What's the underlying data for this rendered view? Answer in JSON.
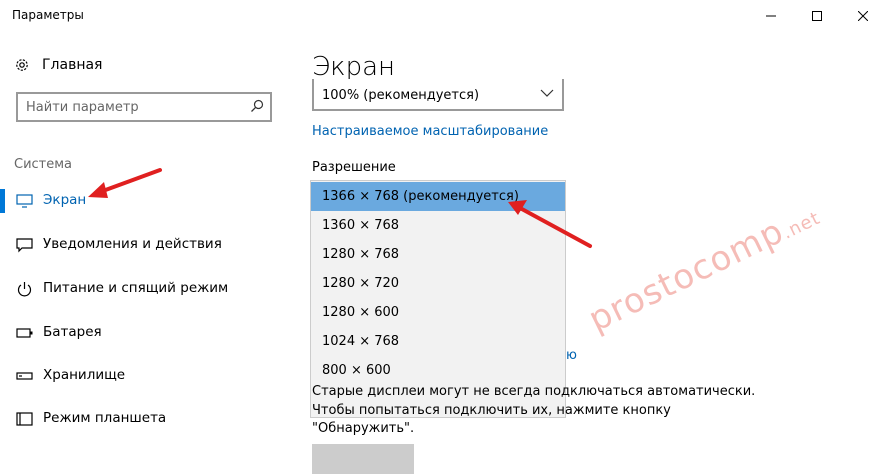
{
  "window": {
    "title": "Параметры"
  },
  "sidebar": {
    "home_label": "Главная",
    "search_placeholder": "Найти параметр",
    "section_label": "Система",
    "items": [
      {
        "label": "Экран",
        "icon": "monitor-icon",
        "active": true
      },
      {
        "label": "Уведомления и действия",
        "icon": "notification-icon",
        "active": false
      },
      {
        "label": "Питание и спящий режим",
        "icon": "power-icon",
        "active": false
      },
      {
        "label": "Батарея",
        "icon": "battery-icon",
        "active": false
      },
      {
        "label": "Хранилище",
        "icon": "storage-icon",
        "active": false
      },
      {
        "label": "Режим планшета",
        "icon": "tablet-mode-icon",
        "active": false
      }
    ]
  },
  "main": {
    "title": "Экран",
    "scale_value": "100% (рекомендуется)",
    "custom_scaling_link": "Настраиваемое масштабирование",
    "resolution_label": "Разрешение",
    "resolution_options": [
      "1366 × 768 (рекомендуется)",
      "1360 × 768",
      "1280 × 768",
      "1280 × 720",
      "1280 × 600",
      "1024 × 768",
      "800 × 600"
    ],
    "resolution_selected": "1366 × 768 (рекомендуется)",
    "hidden_link_fragment": "ю",
    "note_lines": [
      "Старые дисплеи могут не всегда подключаться автоматически.",
      "Чтобы попытаться подключить их, нажмите кнопку",
      "\"Обнаружить\"."
    ]
  },
  "watermark": {
    "text": "prostocomp",
    "suffix": ".net"
  },
  "colors": {
    "accent": "#0078d7",
    "link": "#0063b1",
    "selected": "#6aa9df",
    "arrow": "#e02020"
  }
}
